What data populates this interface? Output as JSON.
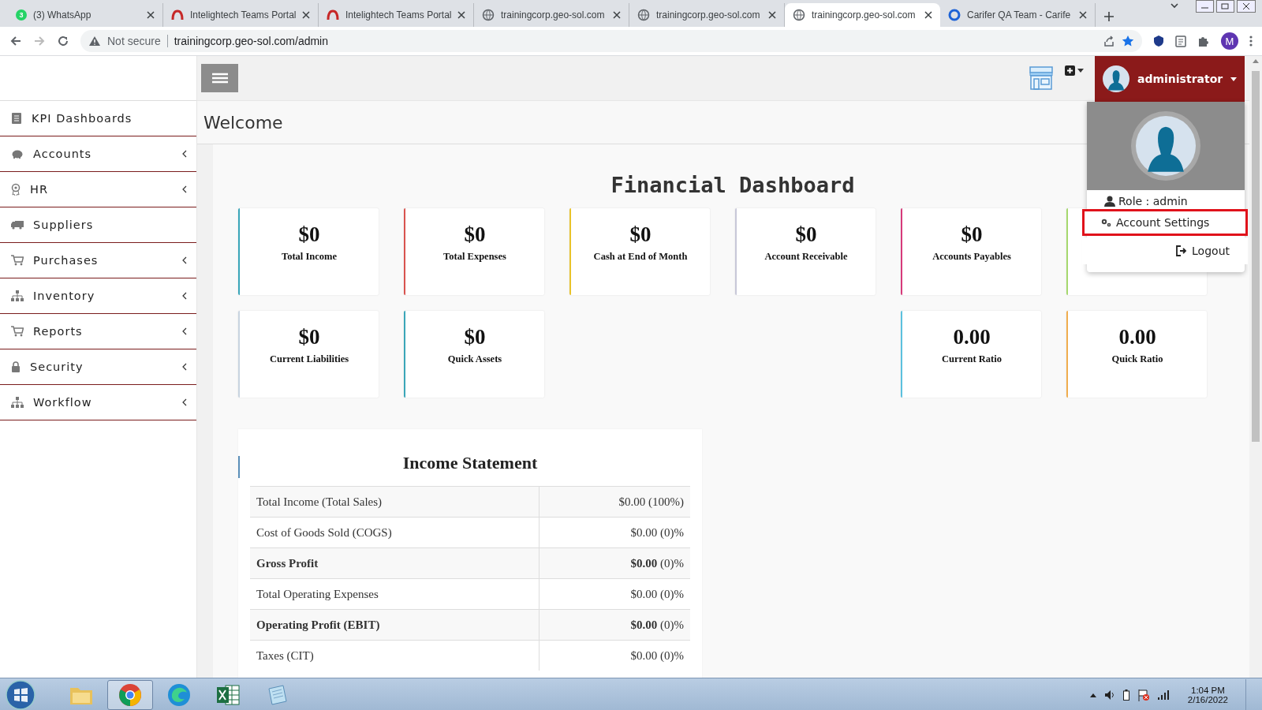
{
  "browser": {
    "tabs": [
      {
        "kind": "whatsapp",
        "badge": "3",
        "title": "(3) WhatsApp",
        "selected": false
      },
      {
        "kind": "teams",
        "title": "Intelightech Teams Portal",
        "selected": false
      },
      {
        "kind": "teams",
        "title": "Intelightech Teams Portal",
        "selected": false
      },
      {
        "kind": "globe",
        "title": "trainingcorp.geo-sol.com",
        "selected": false
      },
      {
        "kind": "globe",
        "title": "trainingcorp.geo-sol.com",
        "selected": false
      },
      {
        "kind": "globe",
        "title": "trainingcorp.geo-sol.com",
        "selected": true
      },
      {
        "kind": "carifer",
        "title": "Carifer QA Team - Carife",
        "selected": false
      }
    ],
    "security": "Not secure",
    "url": "trainingcorp.geo-sol.com/admin",
    "profile_initial": "M"
  },
  "app": {
    "sidebar": [
      {
        "label": "KPI Dashboards",
        "kind": "book",
        "expandable": false
      },
      {
        "label": "Accounts",
        "kind": "piggy",
        "expandable": true
      },
      {
        "label": "HR",
        "kind": "award",
        "expandable": true
      },
      {
        "label": "Suppliers",
        "kind": "truck",
        "expandable": false
      },
      {
        "label": "Purchases",
        "kind": "cart",
        "expandable": true
      },
      {
        "label": "Inventory",
        "kind": "sitemap",
        "expandable": true
      },
      {
        "label": "Reports",
        "kind": "cart",
        "expandable": true
      },
      {
        "label": "Security",
        "kind": "lock",
        "expandable": true
      },
      {
        "label": "Workflow",
        "kind": "sitemap",
        "expandable": true
      }
    ],
    "page_title": "Welcome",
    "user": {
      "name": "administrator",
      "role": "Role : admin",
      "menu": [
        {
          "kind": "settings",
          "label": "Account Settings",
          "highlighted": true
        },
        {
          "kind": "logout",
          "label": "Logout",
          "highlighted": false
        }
      ]
    },
    "dashboard": {
      "title": "Financial Dashboard",
      "row1": [
        {
          "value": "$0",
          "label": "Total Income",
          "color": "#3aa6b9"
        },
        {
          "value": "$0",
          "label": "Total Expenses",
          "color": "#d9534f"
        },
        {
          "value": "$0",
          "label": "Cash at End of Month",
          "color": "#e8c22a"
        },
        {
          "value": "$0",
          "label": "Account Receivable",
          "color": "#c8c8d8"
        },
        {
          "value": "$0",
          "label": "Accounts Payables",
          "color": "#d63a7a"
        },
        {
          "color": "#a6d86e"
        }
      ],
      "row2_left": [
        {
          "value": "$0",
          "label": "Current Liabilities",
          "color": "#c8d4e0"
        },
        {
          "value": "$0",
          "label": "Quick Assets",
          "color": "#3aa6b9"
        }
      ],
      "row2_right": [
        {
          "value": "0.00",
          "label": "Current Ratio",
          "color": "#5bc0de"
        },
        {
          "value": "0.00",
          "label": "Quick Ratio",
          "color": "#f0ad4e"
        }
      ]
    },
    "income_statement": {
      "title": "Income Statement",
      "rows": [
        {
          "label": "Total Income (Total Sales)",
          "value": "$0.00 (100%)",
          "bold": false
        },
        {
          "label": "Cost of Goods Sold (COGS)",
          "value": "$0.00 (0)%",
          "bold": false
        },
        {
          "label": "Gross Profit",
          "value": "**$0.00** (0)%",
          "bold": true
        },
        {
          "label": "Total Operating Expenses",
          "value": "$0.00 (0)%",
          "bold": false
        },
        {
          "label": "Operating Profit (EBIT)",
          "value": "**$0.00** (0)%",
          "bold": true
        },
        {
          "label": "Taxes (CIT)",
          "value": "$0.00 (0)%",
          "bold": false
        }
      ]
    }
  },
  "taskbar": {
    "apps": [
      {
        "kind": "explorer",
        "active": false
      },
      {
        "kind": "chrome",
        "active": true
      },
      {
        "kind": "edge",
        "active": false
      },
      {
        "kind": "excel",
        "active": false
      },
      {
        "kind": "notepad",
        "active": false
      }
    ],
    "time": "1:04 PM",
    "date": "2/16/2022"
  }
}
